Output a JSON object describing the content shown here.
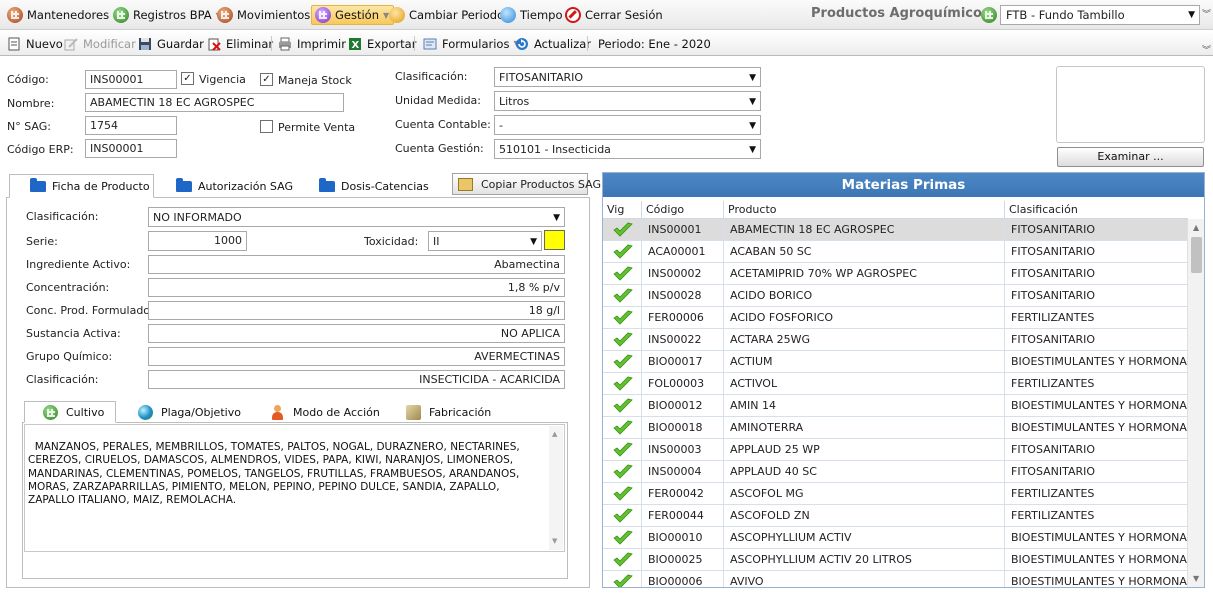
{
  "menu": {
    "items": [
      {
        "label": "Mantenedores",
        "icon": "mantenedores-icon",
        "has_arrow": true
      },
      {
        "label": "Registros BPA",
        "icon": "registros-icon",
        "has_arrow": true
      },
      {
        "label": "Movimientos",
        "icon": "movimientos-icon",
        "has_arrow": true
      },
      {
        "label": "Gestión",
        "icon": "gestion-icon",
        "has_arrow": true
      },
      {
        "label": "Cambiar Periodo",
        "icon": "calendar-icon",
        "has_arrow": false
      },
      {
        "label": "Tiempo",
        "icon": "clock-icon",
        "has_arrow": false
      },
      {
        "label": "Cerrar Sesión",
        "icon": "no-entry-icon",
        "has_arrow": false
      }
    ],
    "app_title": "Productos Agroquímicos",
    "fundo_select": "FTB - Fundo Tambillo"
  },
  "toolbar": {
    "nuevo": "Nuevo",
    "modificar": "Modificar",
    "guardar": "Guardar",
    "eliminar": "Eliminar",
    "imprimir": "Imprimir",
    "exportar": "Exportar",
    "formularios": "Formularios",
    "actualizar": "Actualizar",
    "periodo": "Periodo: Ene - 2020"
  },
  "form": {
    "codigo_label": "Código:",
    "codigo_value": "INS00001",
    "vigencia_label": "Vigencia",
    "vigencia_checked": true,
    "maneja_stock_label": "Maneja Stock",
    "maneja_stock_checked": true,
    "nombre_label": "Nombre:",
    "nombre_value": "ABAMECTIN 18 EC AGROSPEC",
    "sag_label": "N° SAG:",
    "sag_value": "1754",
    "permite_venta_label": "Permite Venta",
    "permite_venta_checked": false,
    "erp_label": "Código ERP:",
    "erp_value": "INS00001",
    "clasificacion_label": "Clasificación:",
    "clasificacion_value": "FITOSANITARIO",
    "unidad_label": "Unidad Medida:",
    "unidad_value": "Litros",
    "cuenta_contable_label": "Cuenta Contable:",
    "cuenta_contable_value": "-",
    "cuenta_gestion_label": "Cuenta Gestión:",
    "cuenta_gestion_value": "510101 - Insecticida",
    "examinar": "Examinar ..."
  },
  "tabs": {
    "items": [
      "Ficha de Producto",
      "Autorización SAG",
      "Dosis-Catencias"
    ],
    "copy_button": "Copiar Productos SAG"
  },
  "ficha": {
    "clasificacion_label": "Clasificación:",
    "clasificacion_value": "NO INFORMADO",
    "serie_label": "Serie:",
    "serie_value": "1000",
    "toxicidad_label": "Toxicidad:",
    "toxicidad_value": "II",
    "toxicidad_color": "#ffff00",
    "ingrediente_label": "Ingrediente Activo:",
    "ingrediente_value": "Abamectina",
    "concentracion_label": "Concentración:",
    "concentracion_value": "1,8 % p/v",
    "conc_form_label": "Conc. Prod. Formulado:",
    "conc_form_value": "18 g/l",
    "sustancia_label": "Sustancia Activa:",
    "sustancia_value": "NO APLICA",
    "grupo_label": "Grupo Químico:",
    "grupo_value": "AVERMECTINAS",
    "clasificacion2_label": "Clasificación:",
    "clasificacion2_value": "INSECTICIDA - ACARICIDA"
  },
  "subtabs": {
    "items": [
      "Cultivo",
      "Plaga/Objetivo",
      "Modo de Acción",
      "Fabricación"
    ],
    "cultivo_text": "MANZANOS, PERALES, MEMBRILLOS, TOMATES, PALTOS, NOGAL, DURAZNERO, NECTARINES, CEREZOS, CIRUELOS, DAMASCOS, ALMENDROS, VIDES, PAPA, KIWI, NARANJOS, LIMONEROS, MANDARINAS, CLEMENTINAS, POMELOS, TANGELOS, FRUTILLAS, FRAMBUESOS, ARANDANOS, MORAS, ZARZAPARRILLAS, PIMIENTO, MELON, PEPINO, PEPINO DULCE, SANDIA, ZAPALLO, ZAPALLO ITALIANO, MAIZ, REMOLACHA."
  },
  "grid": {
    "title": "Materias Primas",
    "columns": [
      "Vig",
      "Código",
      "Producto",
      "Clasificación"
    ],
    "selected_index": 0,
    "rows": [
      {
        "codigo": "INS00001",
        "producto": "ABAMECTIN 18 EC AGROSPEC",
        "clasificacion": "FITOSANITARIO"
      },
      {
        "codigo": "ACA00001",
        "producto": "ACABAN 50 SC",
        "clasificacion": "FITOSANITARIO"
      },
      {
        "codigo": "INS00002",
        "producto": "ACETAMIPRID 70% WP AGROSPEC",
        "clasificacion": "FITOSANITARIO"
      },
      {
        "codigo": "INS00028",
        "producto": "ACIDO BORICO",
        "clasificacion": "FITOSANITARIO"
      },
      {
        "codigo": "FER00006",
        "producto": "ACIDO FOSFORICO",
        "clasificacion": "FERTILIZANTES"
      },
      {
        "codigo": "INS00022",
        "producto": "ACTARA 25WG",
        "clasificacion": "FITOSANITARIO"
      },
      {
        "codigo": "BIO00017",
        "producto": "ACTIUM",
        "clasificacion": "BIOESTIMULANTES Y HORMONAS"
      },
      {
        "codigo": "FOL00003",
        "producto": "ACTIVOL",
        "clasificacion": "FERTILIZANTES"
      },
      {
        "codigo": "BIO00012",
        "producto": "AMIN 14",
        "clasificacion": "BIOESTIMULANTES Y HORMONAS"
      },
      {
        "codigo": "BIO00018",
        "producto": "AMINOTERRA",
        "clasificacion": "BIOESTIMULANTES Y HORMONAS"
      },
      {
        "codigo": "INS00003",
        "producto": "APPLAUD 25 WP",
        "clasificacion": "FITOSANITARIO"
      },
      {
        "codigo": "INS00004",
        "producto": "APPLAUD 40 SC",
        "clasificacion": "FITOSANITARIO"
      },
      {
        "codigo": "FER00042",
        "producto": "ASCOFOL MG",
        "clasificacion": "FERTILIZANTES"
      },
      {
        "codigo": "FER00044",
        "producto": "ASCOFOLD ZN",
        "clasificacion": "FERTILIZANTES"
      },
      {
        "codigo": "BIO00010",
        "producto": "ASCOPHYLLIUM ACTIV",
        "clasificacion": "BIOESTIMULANTES Y HORMONAS"
      },
      {
        "codigo": "BIO00025",
        "producto": "ASCOPHYLLIUM ACTIV 20 LITROS",
        "clasificacion": "BIOESTIMULANTES Y HORMONAS"
      },
      {
        "codigo": "BIO00006",
        "producto": "AVIVO",
        "clasificacion": "BIOESTIMULANTES Y HORMONAS"
      }
    ]
  }
}
